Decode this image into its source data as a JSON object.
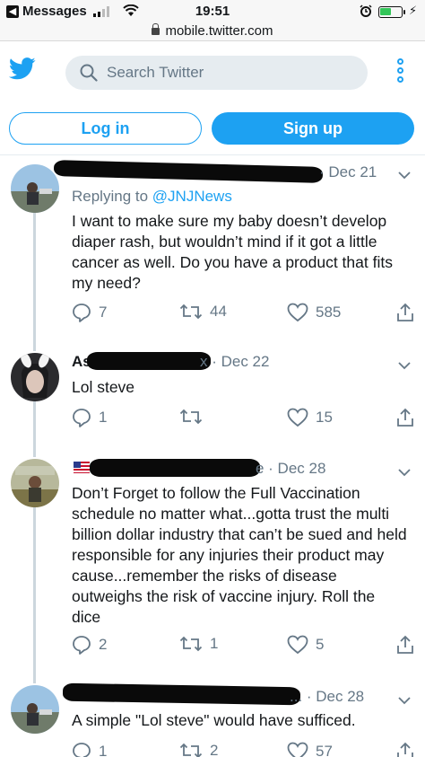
{
  "status_bar": {
    "carrier": "Messages",
    "time": "19:51",
    "charging_symbol": "⚡"
  },
  "url_bar": {
    "url": "mobile.twitter.com"
  },
  "header": {
    "search_placeholder": "Search Twitter"
  },
  "auth": {
    "login_label": "Log in",
    "signup_label": "Sign up"
  },
  "tweets": [
    {
      "date": "· Dec 21",
      "replying_prefix": "Replying to ",
      "replying_handle": "@JNJNews",
      "text": "I want to make sure my baby doesn’t develop diaper rash, but wouldn’t mind if it got a little cancer as well. Do you have a product that fits my need?",
      "replies": "7",
      "retweets": "44",
      "likes": "585"
    },
    {
      "name_fragment": "As",
      "date": "x · Dec 22",
      "text": "Lol steve",
      "replies": "1",
      "retweets": "",
      "likes": "15"
    },
    {
      "date": "e · Dec 28",
      "text": "Don’t Forget to follow the Full Vaccination schedule no matter what...gotta trust the multi billion dollar industry that can’t be sued and held responsible for any injuries their product may cause...remember the risks of disease outweighs the risk of vaccine injury. Roll the dice",
      "replies": "2",
      "retweets": "1",
      "likes": "5"
    },
    {
      "date": "... · Dec 28",
      "text": "A simple \"Lol steve\" would have sufficed.",
      "replies": "1",
      "retweets": "2",
      "likes": "57"
    }
  ],
  "colors": {
    "twitter_blue": "#1da1f2",
    "muted_text": "#657786",
    "body_text": "#14171a",
    "divider": "#e6ecf0",
    "redaction": "#0a0a0a"
  }
}
